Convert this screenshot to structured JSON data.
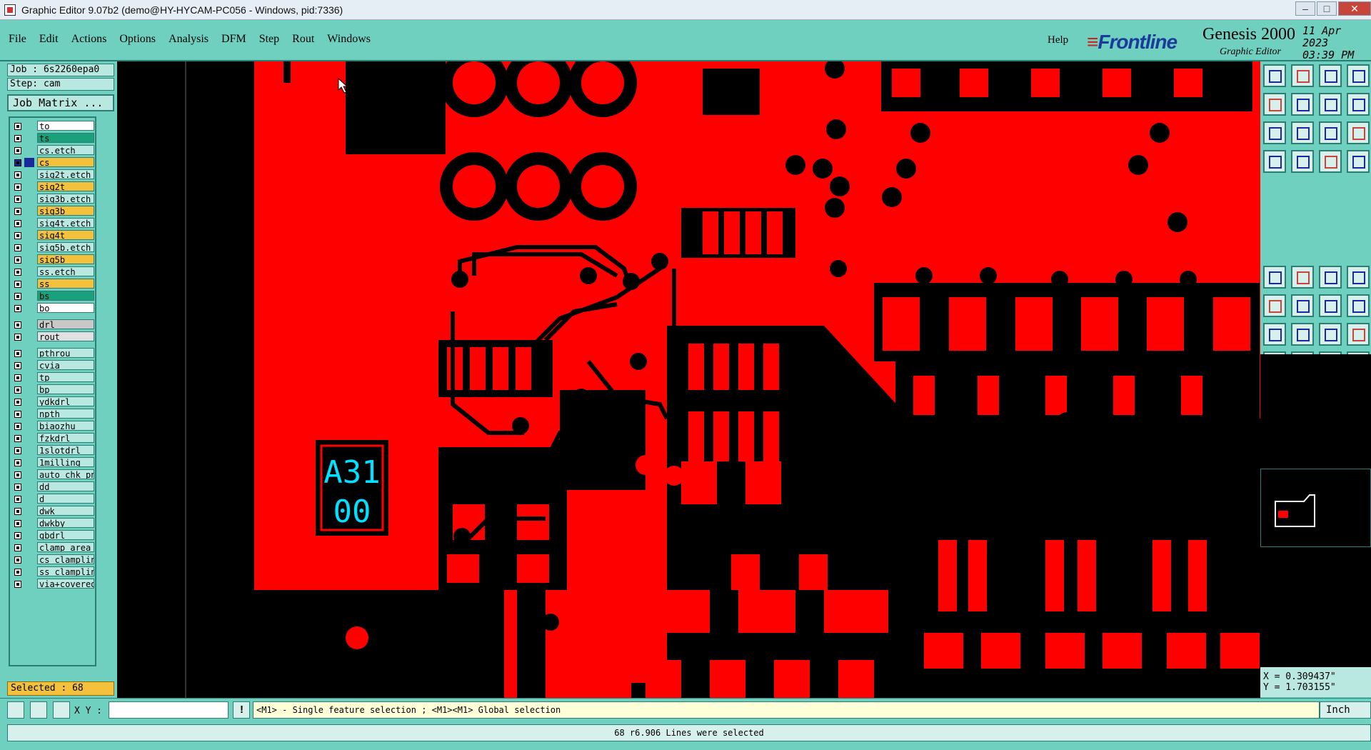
{
  "window": {
    "title": "Graphic Editor 9.07b2 (demo@HY-HYCAM-PC056 - Windows, pid:7336)"
  },
  "menu": [
    "File",
    "Edit",
    "Actions",
    "Options",
    "Analysis",
    "DFM",
    "Step",
    "Rout",
    "Windows"
  ],
  "help": "Help",
  "brand": {
    "logo": "Frontline",
    "product": "Genesis 2000",
    "subtitle": "Graphic Editor",
    "date": "11 Apr 2023",
    "time": "03:39 PM"
  },
  "job": {
    "job": "Job : 6s2260epa0",
    "step": "Step: cam",
    "matrix_button": "Job Matrix ..."
  },
  "layers": [
    {
      "name": "to",
      "color": "#ffffff"
    },
    {
      "name": "ts",
      "color": "#1aa07a"
    },
    {
      "name": "cs.etch",
      "color": "#b8e8e0"
    },
    {
      "name": "cs",
      "color": "#f3c13b",
      "selected": true
    },
    {
      "name": "sig2t.etch",
      "color": "#b8e8e0"
    },
    {
      "name": "sig2t",
      "color": "#f3c13b"
    },
    {
      "name": "sig3b.etch",
      "color": "#b8e8e0"
    },
    {
      "name": "sig3b",
      "color": "#f3c13b"
    },
    {
      "name": "sig4t.etch",
      "color": "#b8e8e0"
    },
    {
      "name": "sig4t",
      "color": "#f3c13b"
    },
    {
      "name": "sig5b.etch",
      "color": "#b8e8e0"
    },
    {
      "name": "sig5b",
      "color": "#f3c13b"
    },
    {
      "name": "ss.etch",
      "color": "#b8e8e0"
    },
    {
      "name": "ss",
      "color": "#f3c13b"
    },
    {
      "name": "bs",
      "color": "#1aa07a"
    },
    {
      "name": "bo",
      "color": "#ffffff"
    },
    {
      "name": "drl",
      "color": "#c8c8c8"
    },
    {
      "name": "rout",
      "color": "#e0e0e0"
    },
    {
      "name": "pthrou",
      "color": "#b8e8e0"
    },
    {
      "name": "cvia",
      "color": "#b8e8e0"
    },
    {
      "name": "tp",
      "color": "#b8e8e0"
    },
    {
      "name": "bp",
      "color": "#b8e8e0"
    },
    {
      "name": "ydkdrl",
      "color": "#b8e8e0"
    },
    {
      "name": "npth",
      "color": "#b8e8e0"
    },
    {
      "name": "biaozhu",
      "color": "#b8e8e0"
    },
    {
      "name": "fzkdrl",
      "color": "#b8e8e0"
    },
    {
      "name": "1slotdrl",
      "color": "#b8e8e0"
    },
    {
      "name": "1milling",
      "color": "#b8e8e0"
    },
    {
      "name": "auto_chk_pn",
      "color": "#b8e8e0"
    },
    {
      "name": "dd",
      "color": "#b8e8e0"
    },
    {
      "name": "d",
      "color": "#b8e8e0"
    },
    {
      "name": "dwk",
      "color": "#b8e8e0"
    },
    {
      "name": "dwkby",
      "color": "#b8e8e0"
    },
    {
      "name": "gbdrl",
      "color": "#b8e8e0"
    },
    {
      "name": "clamp_area",
      "color": "#b8e8e0"
    },
    {
      "name": "cs_clampline",
      "color": "#b8e8e0"
    },
    {
      "name": "ss_clampline",
      "color": "#b8e8e0"
    },
    {
      "name": "via+covered",
      "color": "#b8e8e0"
    }
  ],
  "selected_count": "Selected : 68",
  "canvas": {
    "label_line1": "A31",
    "label_line2": "00",
    "copper": "#ff0000",
    "label_color": "#00e0ff"
  },
  "coords": {
    "x": "X = 0.309437\"",
    "y": "Y = 1.703155\""
  },
  "cmd": {
    "xy_label": "X Y :",
    "xy_value": "",
    "hint": "<M1> - Single feature selection ; <M1><M1> Global selection",
    "unit": "Inch"
  },
  "status": "68 r6.906 Lines were selected"
}
